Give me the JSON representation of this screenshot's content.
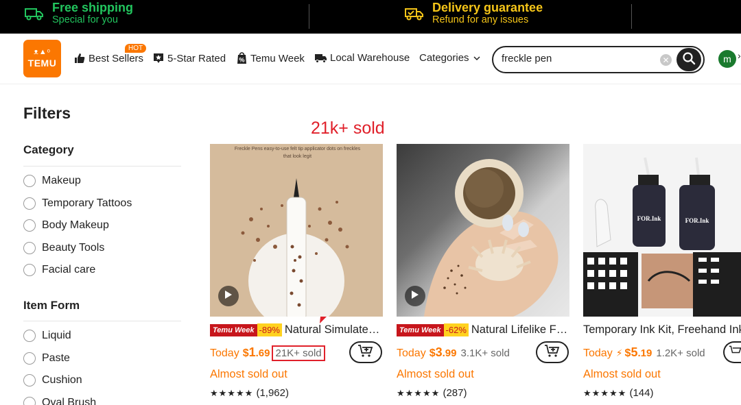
{
  "promo": {
    "left_title": "Free shipping",
    "left_sub": "Special for you",
    "right_title": "Delivery guarantee",
    "right_sub": "Refund for any issues"
  },
  "header": {
    "logo_glyphs": "ᴥ▲ᵒ",
    "logo_text": "TEMU",
    "nav": {
      "best_sellers": "Best Sellers",
      "hot_badge": "HOT",
      "five_star": "5-Star Rated",
      "temu_week": "Temu Week",
      "local_warehouse": "Local Warehouse",
      "categories": "Categories"
    },
    "search_value": "freckle pen",
    "avatar_letter": "m"
  },
  "filters": {
    "title": "Filters",
    "category_title": "Category",
    "categories": [
      "Makeup",
      "Temporary Tattoos",
      "Body Makeup",
      "Beauty Tools",
      "Facial care"
    ],
    "item_form_title": "Item Form",
    "item_forms": [
      "Liquid",
      "Paste",
      "Cushion",
      "Oval Brush"
    ]
  },
  "annotation": "21k+ sold",
  "products": [
    {
      "week_badge": "Temu Week",
      "discount": "-89%",
      "title": "Natural Simulated Freckle Pen",
      "today": "Today",
      "currency": "$",
      "price_int": "1",
      "price_dec": ".69",
      "sold": "21K+ sold",
      "almost": "Almost sold out",
      "stars": "★★★★★",
      "reviews": "(1,962)",
      "image_caption": "Freckle Pens easy-to-use felt tip applicator dots on freckles that look legit"
    },
    {
      "week_badge": "Temu Week",
      "discount": "-62%",
      "title": "Natural Lifelike Freckle Stamp",
      "today": "Today",
      "currency": "$",
      "price_int": "3",
      "price_dec": ".99",
      "sold": "3.1K+ sold",
      "almost": "Almost sold out",
      "stars": "★★★★★",
      "reviews": "(287)"
    },
    {
      "title": "Temporary Ink Kit, Freehand Ink",
      "today": "Today",
      "currency": "$",
      "price_int": "5",
      "price_dec": ".19",
      "sold": "1.2K+ sold",
      "almost": "Almost sold out",
      "stars": "★★★★★",
      "reviews": "(144)",
      "bottle_label": "FOR.Ink"
    }
  ],
  "colors": {
    "brand_orange": "#fb7701",
    "promo_green": "#22c55e",
    "annotation_red": "#e0202a",
    "badge_red": "#c7161c",
    "badge_yellow": "#ffd21f"
  }
}
